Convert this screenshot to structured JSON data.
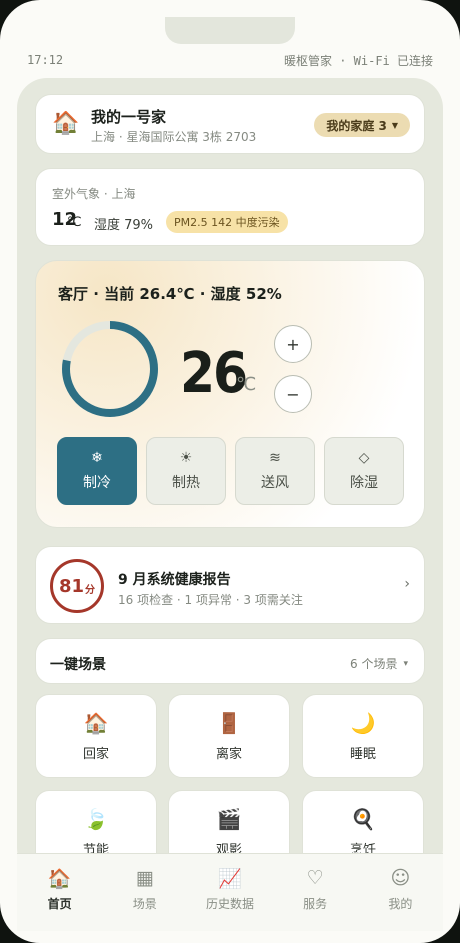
{
  "status": {
    "time": "17:12",
    "right": "暖枢管家 · Wi-Fi 已连接"
  },
  "home": {
    "title": "我的一号家",
    "address": "上海 · 星海国际公寓 3栋 2703",
    "family_label": "我的家庭 3",
    "icon": "house-icon"
  },
  "weather": {
    "label": "室外气象 · 上海",
    "temp": "12",
    "unit": "℃",
    "humidity": "湿度 79%",
    "pm": "PM2.5 142 中度污染"
  },
  "climate": {
    "title": "客厅 · 当前 26.4℃ · 湿度 52%",
    "setpoint": "26",
    "unit": "℃",
    "ring_fill": 0.78,
    "plus": "+",
    "minus": "−",
    "modes": [
      {
        "label": "制冷",
        "glyph": "❄",
        "icon": "snowflake-icon",
        "active": true
      },
      {
        "label": "制热",
        "glyph": "☀",
        "icon": "sun-icon",
        "active": false
      },
      {
        "label": "送风",
        "glyph": "≋",
        "icon": "wind-icon",
        "active": false
      },
      {
        "label": "除湿",
        "glyph": "◇",
        "icon": "droplet-icon",
        "active": false
      }
    ]
  },
  "report": {
    "score": "81",
    "score_unit": "分",
    "title": "9 月系统健康报告",
    "subtitle": "16 项检查 · 1 项异常 · 3 项需关注",
    "chevron": "›"
  },
  "scenes": {
    "title": "一键场景",
    "count": "6  个场景",
    "chevron": "▾",
    "items": [
      {
        "label": "回家",
        "glyph": "🏠",
        "icon": "house-icon"
      },
      {
        "label": "离家",
        "glyph": "🚪",
        "icon": "door-icon"
      },
      {
        "label": "睡眠",
        "glyph": "🌙",
        "icon": "moon-icon"
      },
      {
        "label": "节能",
        "glyph": "🍃",
        "icon": "leaf-icon"
      },
      {
        "label": "观影",
        "glyph": "🎬",
        "icon": "clapper-icon"
      },
      {
        "label": "烹饪",
        "glyph": "🍳",
        "icon": "pan-icon"
      }
    ]
  },
  "tabs": [
    {
      "label": "首页",
      "glyph": "🏠",
      "icon": "home-icon",
      "active": true
    },
    {
      "label": "场景",
      "glyph": "▦",
      "icon": "grid-icon",
      "active": false
    },
    {
      "label": "历史数据",
      "glyph": "📈",
      "icon": "chart-icon",
      "active": false
    },
    {
      "label": "服务",
      "glyph": "♡",
      "icon": "heart-icon",
      "active": false
    },
    {
      "label": "我的",
      "glyph": "☺",
      "icon": "user-icon",
      "active": false
    }
  ],
  "colors": {
    "accent": "#2d6f84",
    "score": "#a5372a",
    "pill": "#ecdcb2",
    "pm": "#f7e2a7"
  }
}
